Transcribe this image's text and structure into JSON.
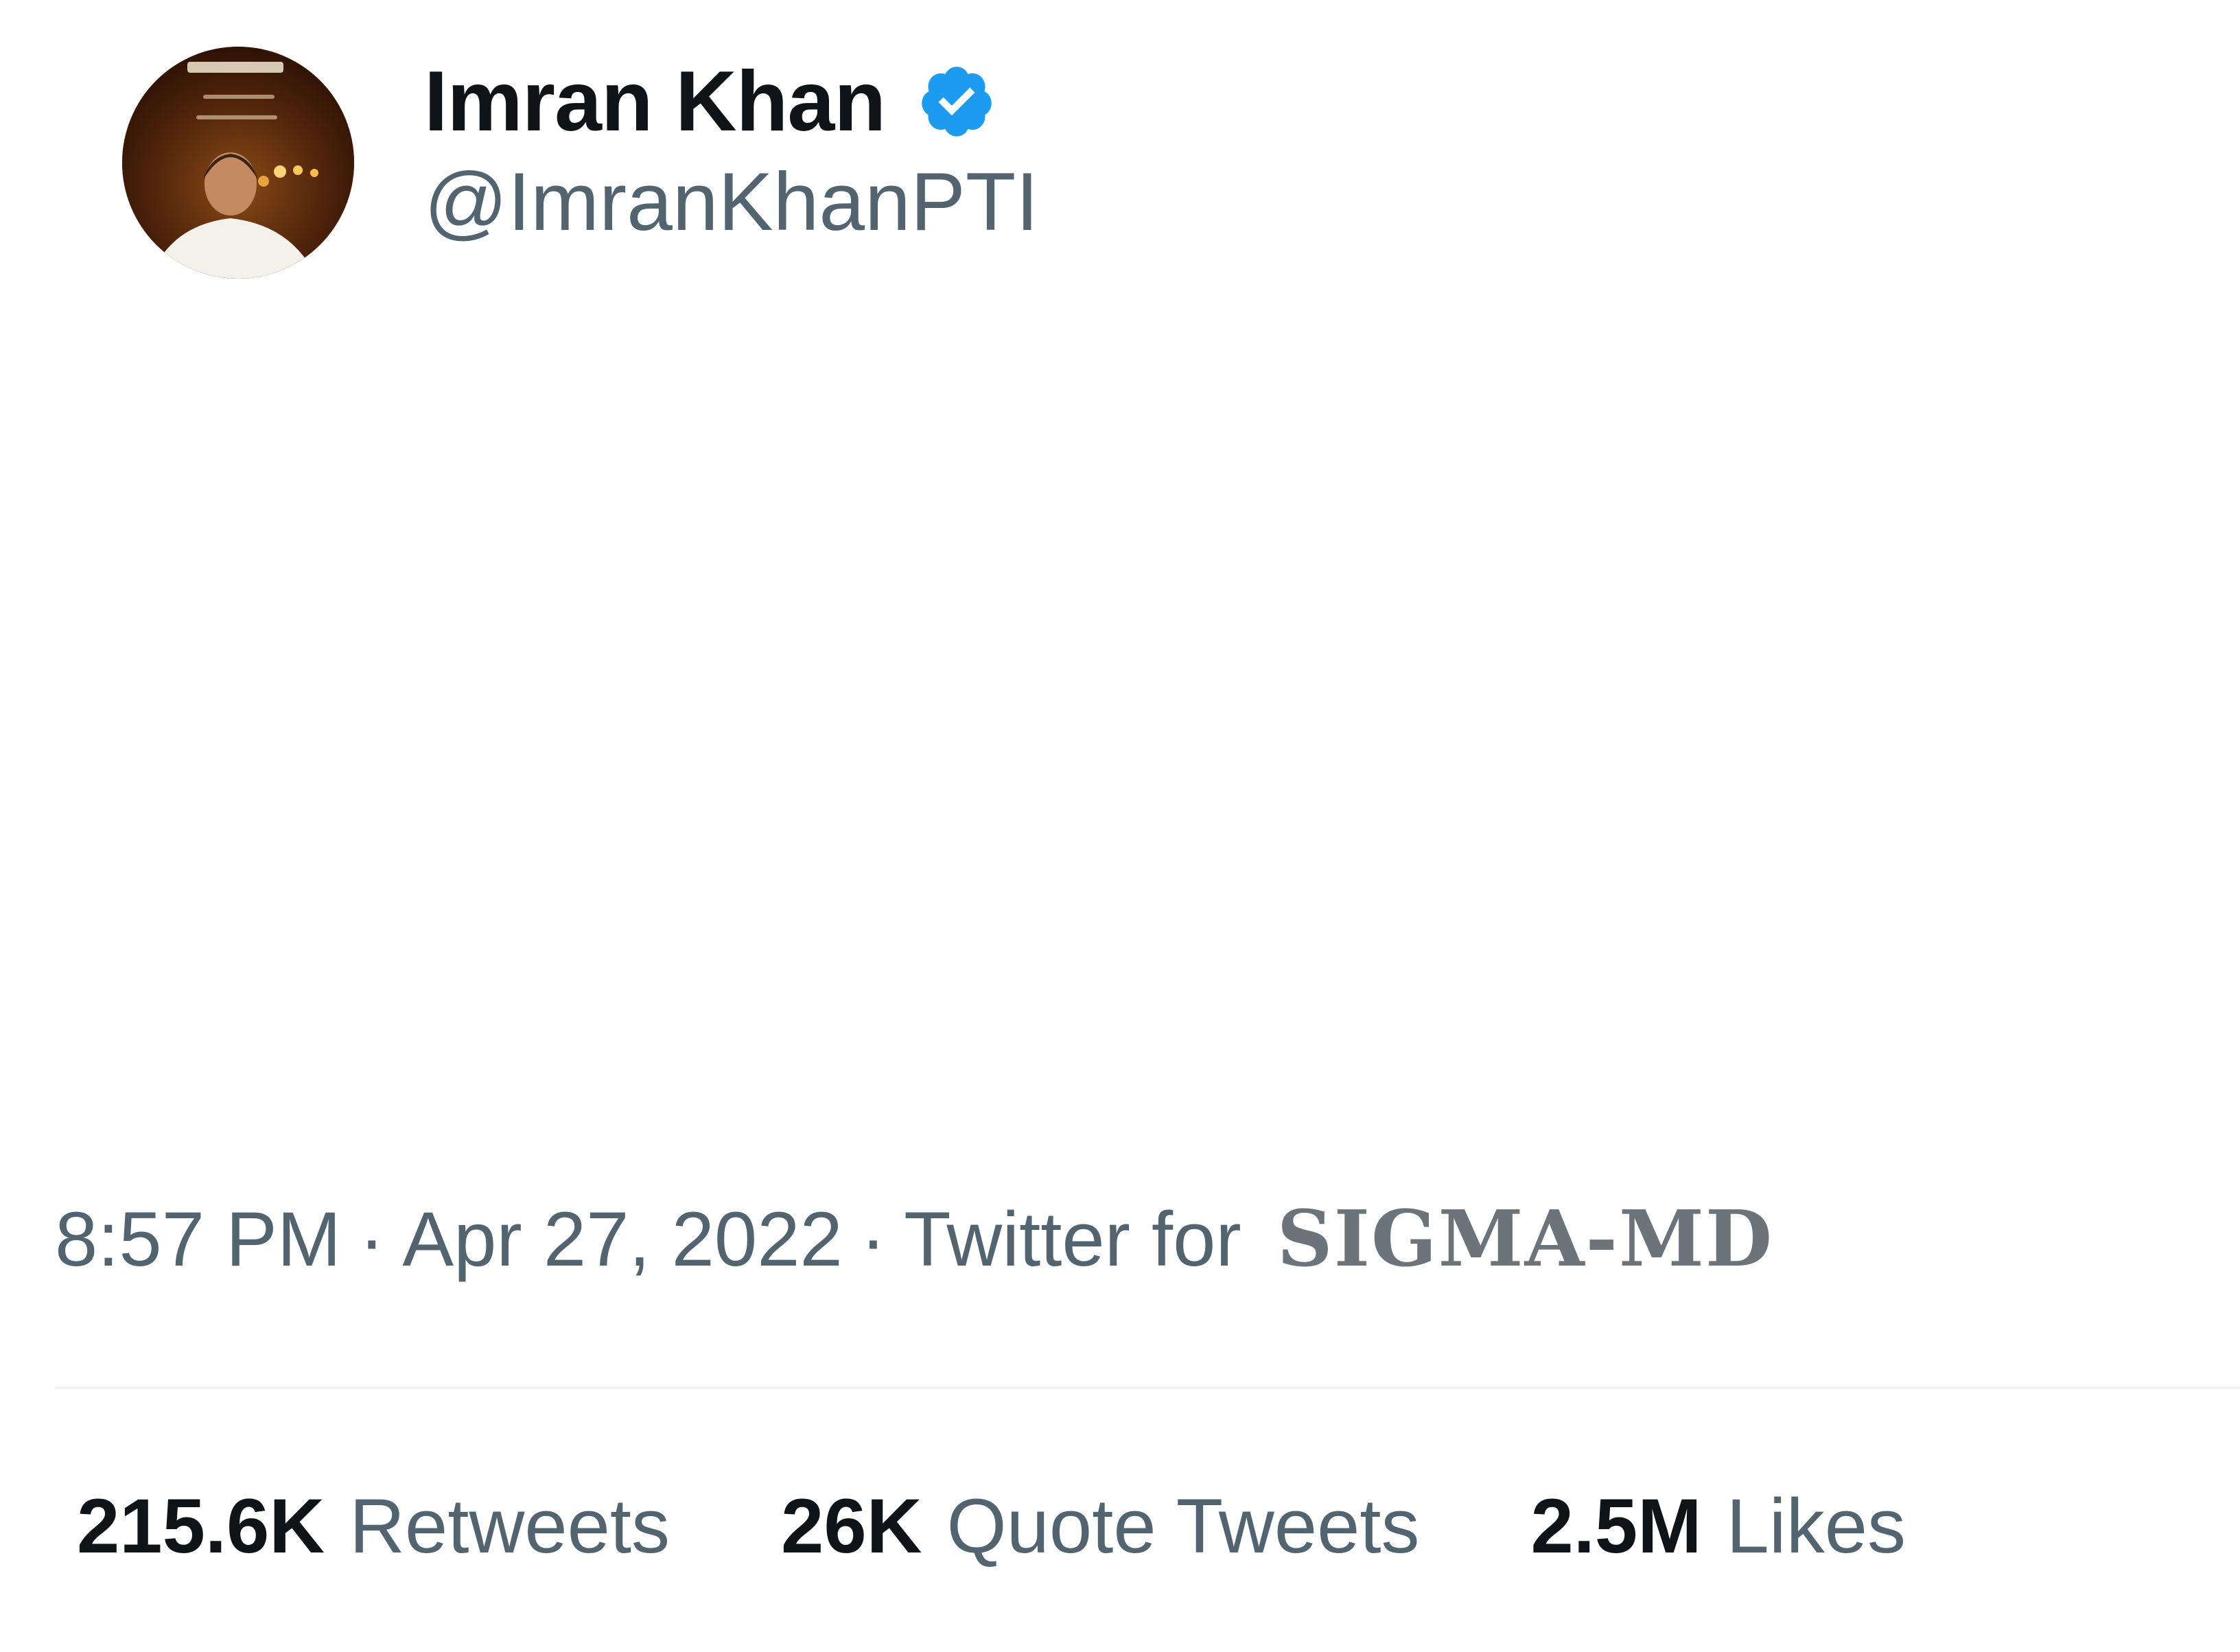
{
  "author": {
    "display_name": "Imran Khan",
    "handle": "@ImranKhanPTI",
    "verified_icon": "verified-badge-icon",
    "avatar_icon": "profile-photo"
  },
  "tweet": {
    "time": "8:57 PM",
    "separator": "·",
    "date": "Apr 27, 2022",
    "client_prefix": "Twitter for",
    "client": "SIGMA-MD"
  },
  "stats": {
    "retweets": {
      "count": "215.6K",
      "label": "Retweets"
    },
    "quote_tweets": {
      "count": "26K",
      "label": "Quote Tweets"
    },
    "likes": {
      "count": "2.5M",
      "label": "Likes"
    }
  },
  "colors": {
    "primary_text": "#0f1419",
    "secondary_text": "#536471",
    "verified_blue": "#1d9bf0",
    "divider": "#eff3f4"
  }
}
